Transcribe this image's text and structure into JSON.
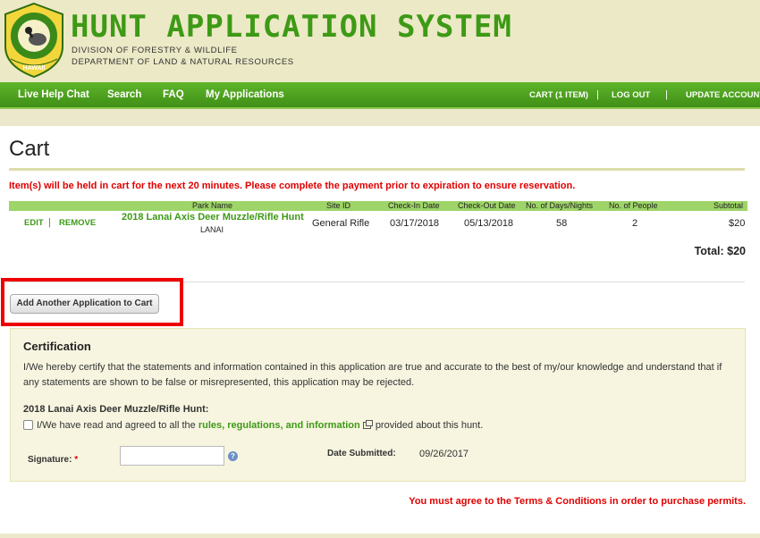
{
  "header": {
    "title": "HUNT APPLICATION SYSTEM",
    "subtitle1": "DIVISION OF FORESTRY & WILDLIFE",
    "subtitle2": "DEPARTMENT OF LAND & NATURAL RESOURCES",
    "logo": {
      "ring_top": "FORESTRY AND WILDLIFE",
      "ring_bottom": "HAWAII",
      "icon": "nene-goose-seal"
    }
  },
  "nav": {
    "items": [
      "Live Help Chat",
      "Search",
      "FAQ",
      "My Applications"
    ],
    "cart": "CART (1 ITEM)",
    "logout": "LOG OUT",
    "update_account": "UPDATE ACCOUNT",
    "separator": "|"
  },
  "cart": {
    "title": "Cart",
    "hold_message": "Item(s) will be held in cart for the next 20 minutes. Please complete the payment prior to expiration to ensure reservation.",
    "columns": [
      "Park Name",
      "Site ID",
      "Check-In Date",
      "Check-Out Date",
      "No. of Days/Nights",
      "No. of People",
      "Subtotal"
    ],
    "row": {
      "edit": "EDIT",
      "remove": "REMOVE",
      "park_name": "2018 Lanai Axis Deer Muzzle/Rifle Hunt",
      "park_location": "LANAI",
      "site_id": "General Rifle",
      "check_in": "03/17/2018",
      "check_out": "05/13/2018",
      "days": "58",
      "people": "2",
      "subtotal": "$20"
    },
    "total": "Total: $20",
    "add_button": "Add Another Application to Cart"
  },
  "certification": {
    "title": "Certification",
    "text": "I/We hereby certify that the statements and information contained in this application are true and accurate to the best of my/our knowledge and understand that if any statements are shown to be false or misrepresented, this application may be rejected.",
    "hunt_label": "2018 Lanai Axis Deer Muzzle/Rifle Hunt:",
    "checkbox_prefix": "I/We have read and agreed to all the",
    "rules_link": "rules, regulations, and information",
    "checkbox_suffix": "provided about this hunt.",
    "signature_label": "Signature:",
    "required_marker": "*",
    "signature_value": "",
    "date_label": "Date Submitted:",
    "date_value": "09/26/2017",
    "help_icon": "?"
  },
  "terms_message": "You must agree to the Terms & Conditions in order to purchase permits.",
  "colors": {
    "brand_green": "#3d9a16",
    "nav_green": "#4fa420",
    "error_red": "#e00000",
    "highlight_red": "#ee0000"
  }
}
